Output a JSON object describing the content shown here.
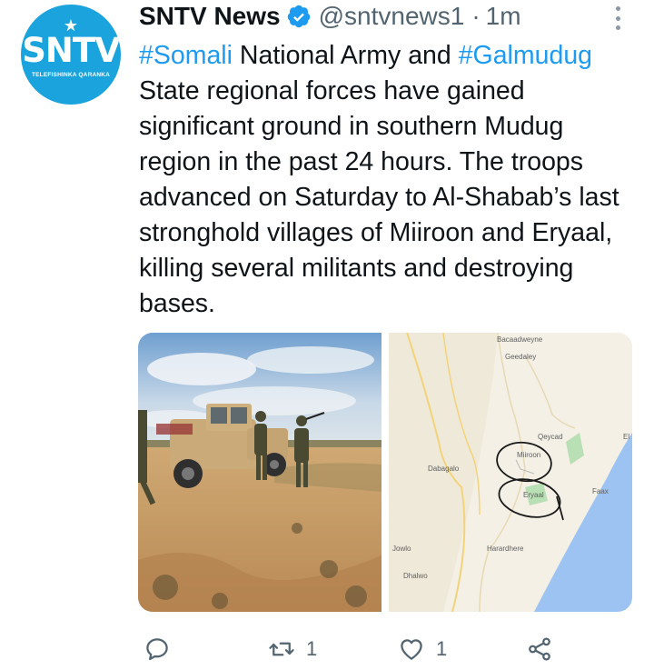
{
  "avatar": {
    "logo_text": "SNTV",
    "tagline": "TELEFISHINKA QARANKA",
    "color": "#1aa3dc"
  },
  "header": {
    "name": "SNTV News",
    "handle": "@sntvnews1",
    "separator": "·",
    "time": "1m"
  },
  "tweet": {
    "hashtag_1": "#Somali",
    "text_1": " National Army and ",
    "hashtag_2": "#Galmudug",
    "text_2": " State regional forces have gained significant ground in southern Mudug region in the past 24 hours. The troops advanced on Saturday to Al-Shabab’s last stronghold villages of Miiroon and Eryaal, killing several militants and destroying bases."
  },
  "map_labels": {
    "bacaadweyne": "Bacaadweyne",
    "geedaley": "Geedaley",
    "qeycad": "Qeycad",
    "miiroon": "Miiroon",
    "dabagalo": "Dabagalo",
    "eryaal": "Eryaal",
    "faax": "Faax",
    "el": "El",
    "harardhere": "Harardhere",
    "jowlo": "Jowlo",
    "dhalwo": "Dhalwo"
  },
  "actions": {
    "reply_icon": "reply-icon",
    "retweet_icon": "retweet-icon",
    "retweet_count": "1",
    "like_icon": "heart-icon",
    "like_count": "1",
    "share_icon": "share-icon"
  },
  "colors": {
    "link": "#1d9bf0",
    "secondary": "#536471",
    "verified": "#1d9bf0"
  }
}
